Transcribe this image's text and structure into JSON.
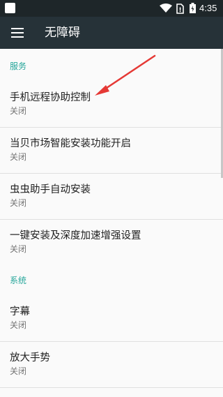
{
  "status": {
    "time": "4:35"
  },
  "app_bar": {
    "title": "无障碍"
  },
  "sections": [
    {
      "header": "服务",
      "items": [
        {
          "title": "手机远程协助控制",
          "summary": "关闭"
        },
        {
          "title": "当贝市场智能安装功能开启",
          "summary": "关闭"
        },
        {
          "title": "虫虫助手自动安装",
          "summary": "关闭"
        },
        {
          "title": "一键安装及深度加速增强设置",
          "summary": "关闭"
        }
      ]
    },
    {
      "header": "系统",
      "items": [
        {
          "title": "字幕",
          "summary": "关闭"
        },
        {
          "title": "放大手势",
          "summary": "关闭"
        }
      ]
    }
  ],
  "colors": {
    "accent": "#26a69a",
    "app_bar": "#263238",
    "status_bar": "#1e2629",
    "arrow": "#e53935"
  }
}
